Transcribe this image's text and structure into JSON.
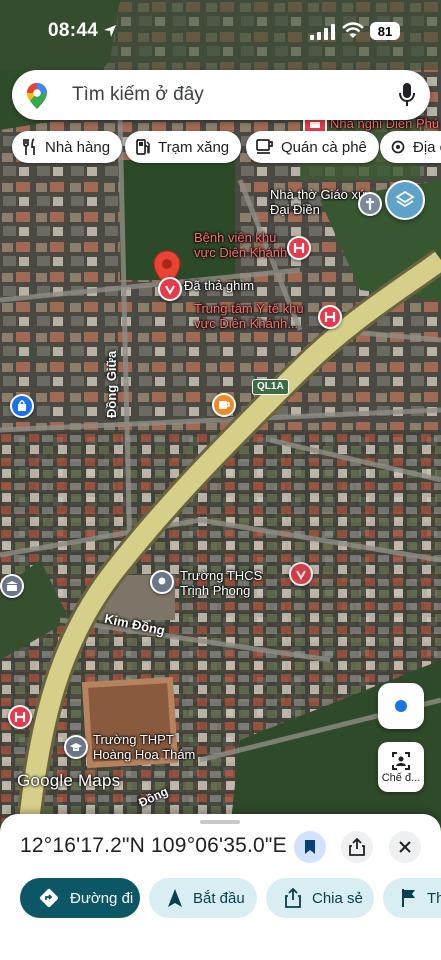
{
  "status_bar": {
    "time": "08:44",
    "battery": "81"
  },
  "search": {
    "placeholder": "Tìm kiếm ở đây"
  },
  "chips": [
    {
      "label": "Nhà hàng",
      "icon": "fork-knife-icon"
    },
    {
      "label": "Trạm xăng",
      "icon": "gas-station-icon"
    },
    {
      "label": "Quán cà phê",
      "icon": "coffee-cup-icon"
    },
    {
      "label": "Địa c",
      "icon": "attraction-icon"
    }
  ],
  "map": {
    "places": {
      "guesthouse": "Nhà nghỉ Diên Phú",
      "church": "Nhà thờ Giáo xứ Đại Điền",
      "hospital": "Bệnh viện khu vực Diên Khánh",
      "dropped_pin": "Đã thả ghim",
      "medical_center": "Trung tâm Y tế khu vực Diên Khánh...",
      "school_thcs": "Trường THCS Trịnh Phong",
      "school_thpt": "Trường THPT Hoàng Hoa Thám"
    },
    "roads": {
      "dong_giua": "Đồng Giữa",
      "kim_dong": "Kim Đồng",
      "ql1a": "QL1A",
      "bottom_road": "Đồng"
    },
    "colors": {
      "hospital": "#e8394b",
      "pin": "#ea4335",
      "coffee": "#f08a24",
      "shopping": "#1a73e8"
    }
  },
  "controls": {
    "street_view_label": "Chế đ..."
  },
  "branding": {
    "logo": "Google Maps"
  },
  "sheet": {
    "coordinates": "12°16'17.2\"N 109°06'35.0\"E",
    "actions": [
      {
        "label": "Đường đi",
        "icon": "directions-icon"
      },
      {
        "label": "Bắt đầu",
        "icon": "navigation-arrow-icon"
      },
      {
        "label": "Chia sẻ",
        "icon": "share-icon"
      },
      {
        "label": "Th",
        "icon": "flag-icon"
      }
    ]
  }
}
